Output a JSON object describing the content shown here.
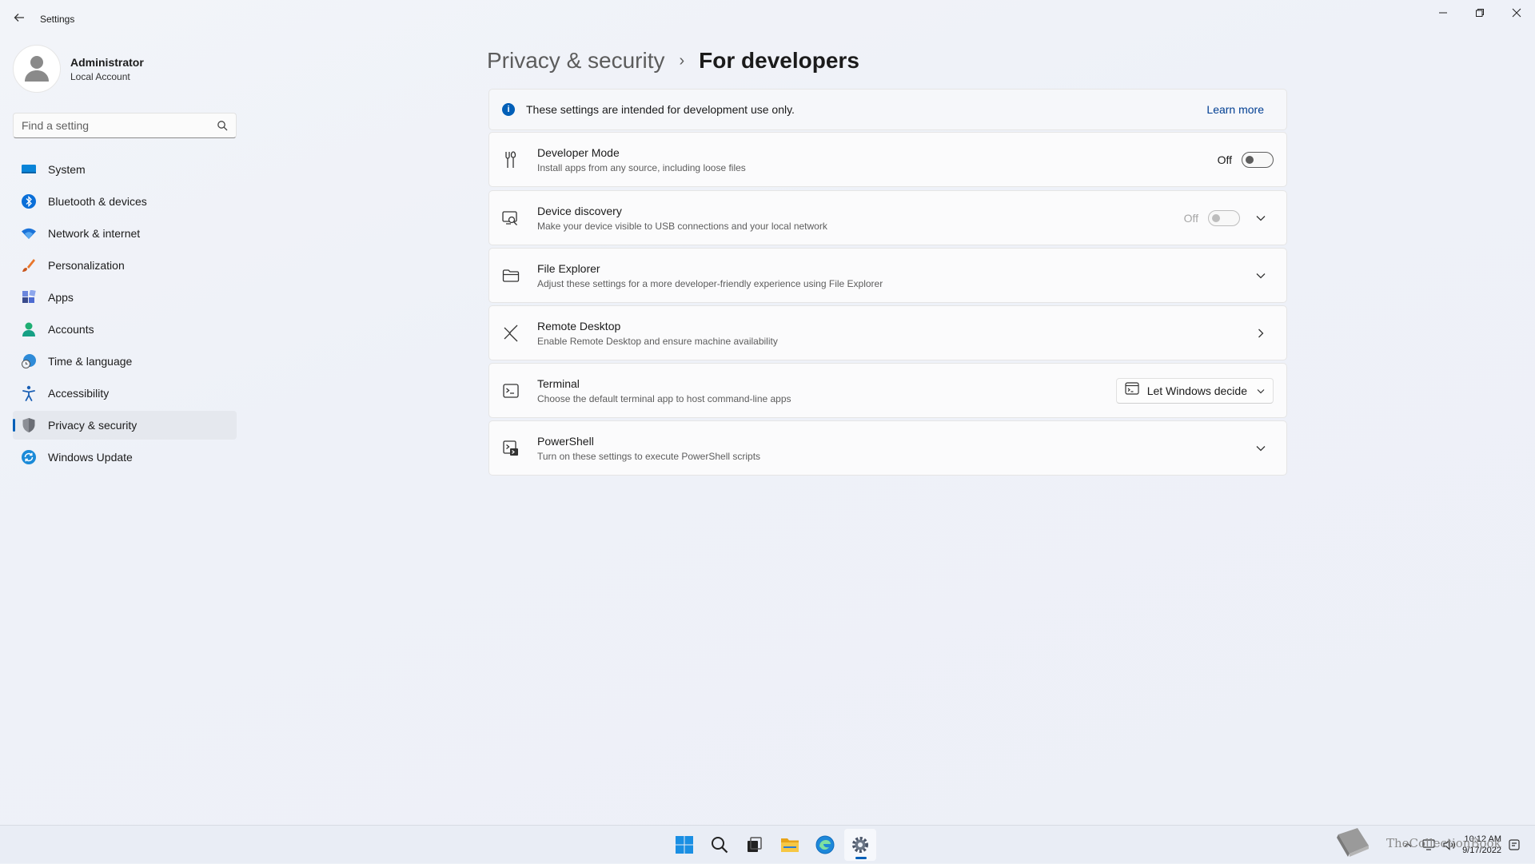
{
  "window": {
    "title": "Settings"
  },
  "user": {
    "name": "Administrator",
    "account_type": "Local Account"
  },
  "search": {
    "placeholder": "Find a setting"
  },
  "sidebar": {
    "items": [
      {
        "label": "System",
        "icon": "monitor-icon"
      },
      {
        "label": "Bluetooth & devices",
        "icon": "bluetooth-icon"
      },
      {
        "label": "Network & internet",
        "icon": "wifi-icon"
      },
      {
        "label": "Personalization",
        "icon": "brush-icon"
      },
      {
        "label": "Apps",
        "icon": "apps-icon"
      },
      {
        "label": "Accounts",
        "icon": "person-icon"
      },
      {
        "label": "Time & language",
        "icon": "globe-clock-icon"
      },
      {
        "label": "Accessibility",
        "icon": "accessibility-icon"
      },
      {
        "label": "Privacy & security",
        "icon": "shield-icon",
        "selected": true
      },
      {
        "label": "Windows Update",
        "icon": "update-icon"
      }
    ]
  },
  "breadcrumb": {
    "parent": "Privacy & security",
    "separator": "›",
    "current": "For developers"
  },
  "infobar": {
    "text": "These settings are intended for development use only.",
    "link": "Learn more"
  },
  "settings": {
    "developer_mode": {
      "title": "Developer Mode",
      "desc": "Install apps from any source, including loose files",
      "state": "Off"
    },
    "device_discovery": {
      "title": "Device discovery",
      "desc": "Make your device visible to USB connections and your local network",
      "state": "Off"
    },
    "file_explorer": {
      "title": "File Explorer",
      "desc": "Adjust these settings for a more developer-friendly experience using File Explorer"
    },
    "remote_desktop": {
      "title": "Remote Desktop",
      "desc": "Enable Remote Desktop and ensure machine availability"
    },
    "terminal": {
      "title": "Terminal",
      "desc": "Choose the default terminal app to host command-line apps",
      "selected": "Let Windows decide"
    },
    "powershell": {
      "title": "PowerShell",
      "desc": "Turn on these settings to execute PowerShell scripts"
    }
  },
  "taskbar": {
    "apps": [
      "start-icon",
      "search-icon",
      "task-view-icon",
      "file-explorer-icon",
      "edge-icon",
      "settings-icon"
    ],
    "watermark": "TheCollectionBook",
    "time": "10:12 AM",
    "date": "9/17/2022"
  },
  "colors": {
    "accent": "#005fb8",
    "background": "#eef2f8"
  }
}
